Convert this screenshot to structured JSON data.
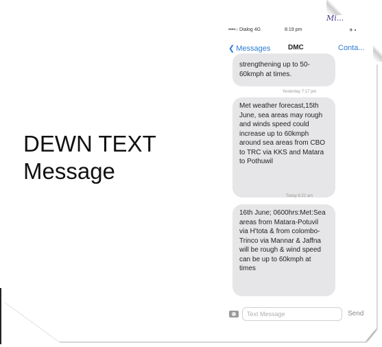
{
  "slide": {
    "title_line1": "DEWN TEXT",
    "title_line2": "Message",
    "signature": "Mi..."
  },
  "phone": {
    "status": {
      "carrier": "••••○ Dialog  4G",
      "time": "8:19 pm",
      "right": "✈ ▪"
    },
    "nav": {
      "back_label": "Messages",
      "title": "DMC",
      "contact_label": "Conta..."
    },
    "messages": [
      {
        "text": "strengthening up to 50-60kmph at times."
      },
      {
        "timestamp": "Yesterday 7:17 pm",
        "text": "Met weather forecast,15th June, sea areas may rough and winds speed could increase up to 60kmph around sea areas from CBO to TRC via KKS and Matara to Pothuwil"
      },
      {
        "timestamp": "Today 6:22 am",
        "text": "16th June; 0600hrs:Met:Sea areas from Matara-Potuvil via H'tota & from colombo-Trinco via Mannar & Jaffna will be rough & wind speed can be up to 60kmph at times"
      }
    ],
    "composer": {
      "placeholder": "Text Message",
      "send_label": "Send"
    }
  },
  "icons": [
    "camera-icon",
    "chevron-left-icon"
  ],
  "colors": {
    "ios_blue": "#2b7cd3",
    "bubble_gray": "#e6e6e8"
  }
}
